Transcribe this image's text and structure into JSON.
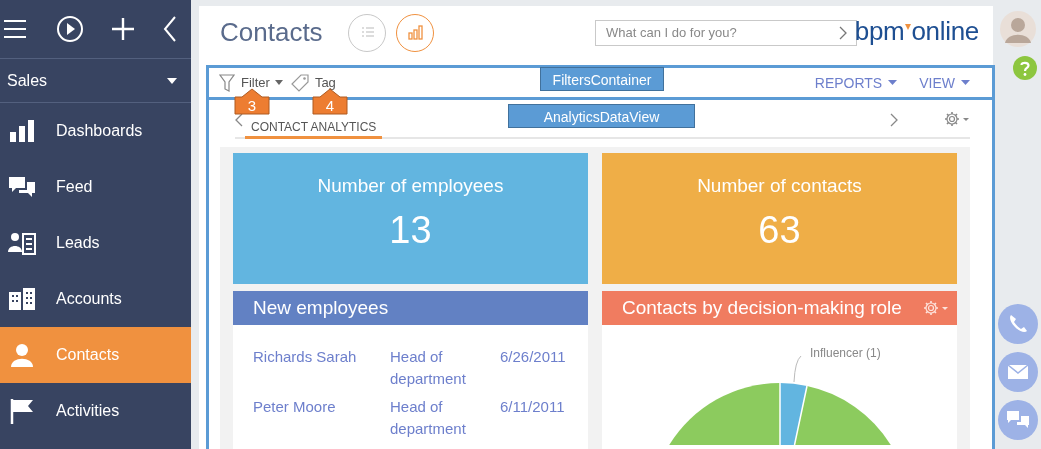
{
  "sidebar": {
    "workspace": "Sales",
    "items": [
      {
        "label": "Dashboards",
        "selected": false
      },
      {
        "label": "Feed",
        "selected": false
      },
      {
        "label": "Leads",
        "selected": false
      },
      {
        "label": "Accounts",
        "selected": false
      },
      {
        "label": "Contacts",
        "selected": true
      },
      {
        "label": "Activities",
        "selected": false
      }
    ]
  },
  "header": {
    "title": "Contacts",
    "view_buttons": [
      {
        "kind": "list",
        "selected": false
      },
      {
        "kind": "analytics",
        "selected": true
      }
    ],
    "search": {
      "placeholder": "What can I do for you?"
    },
    "logo": {
      "left": "bpm",
      "right": "online"
    }
  },
  "filters": {
    "filter": "Filter",
    "tag": "Tag",
    "actions": [
      "REPORTS",
      "VIEW"
    ]
  },
  "tabs": [
    {
      "label": "CONTACT ANALYTICS",
      "selected": true
    }
  ],
  "tiles": [
    {
      "title": "Number of employees",
      "value": "13",
      "color": "#62b5e0"
    },
    {
      "title": "Number of contacts",
      "value": "63",
      "color": "#efae47"
    }
  ],
  "widgets": [
    {
      "kind": "list",
      "title": "New employees",
      "color": "#6281c3",
      "rows": [
        {
          "name": "Richards Sarah",
          "role": "Head of department",
          "date": "6/26/2011"
        },
        {
          "name": "Peter Moore",
          "role": "Head of department",
          "date": "6/11/2011"
        }
      ]
    },
    {
      "kind": "pie",
      "title": "Contacts by decision-making role",
      "color": "#f07c60",
      "label": "Influencer (1)"
    }
  ],
  "annotations": {
    "frames": [
      "FiltersContainer",
      "AnalyticsDataView"
    ],
    "callouts": [
      "3",
      "4"
    ]
  }
}
